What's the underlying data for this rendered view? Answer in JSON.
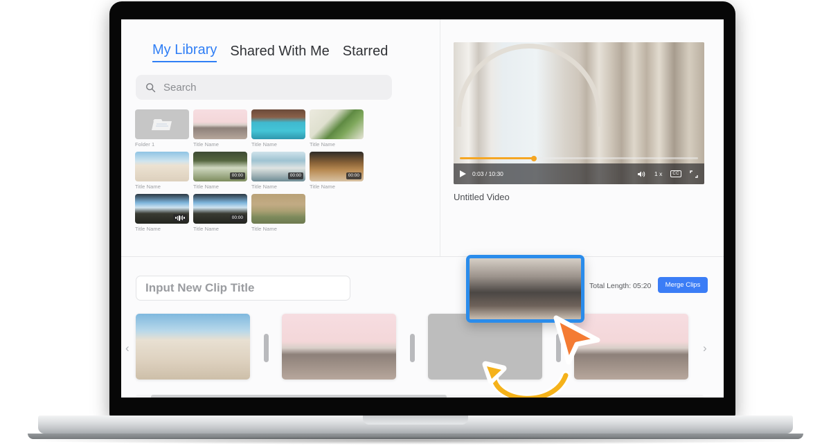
{
  "app": {
    "library": {
      "tabs": [
        {
          "label": "My Library",
          "active": true
        },
        {
          "label": "Shared With Me",
          "active": false
        },
        {
          "label": "Starred",
          "active": false
        }
      ],
      "search": {
        "placeholder": "Search",
        "value": "",
        "icon": "search-icon"
      },
      "items": [
        {
          "label": "Folder 1",
          "kind": "folder",
          "art": "folder",
          "badge": null
        },
        {
          "label": "Title Name",
          "kind": "video",
          "art": "art-van",
          "badge": null
        },
        {
          "label": "Title Name",
          "kind": "video",
          "art": "art-kayak",
          "badge": null
        },
        {
          "label": "Title Name",
          "kind": "video",
          "art": "art-fern",
          "badge": null
        },
        {
          "label": "Title Name",
          "kind": "video",
          "art": "art-beach",
          "badge": null
        },
        {
          "label": "Title Name",
          "kind": "video",
          "art": "art-drink",
          "badge": "00:00"
        },
        {
          "label": "Title Name",
          "kind": "video",
          "art": "art-window",
          "badge": "00:00"
        },
        {
          "label": "Title Name",
          "kind": "video",
          "art": "art-wood",
          "badge": "00:00"
        },
        {
          "label": "Title Name",
          "kind": "audio",
          "art": "art-road",
          "badge": "waveform-icon"
        },
        {
          "label": "Title Name",
          "kind": "video",
          "art": "art-road",
          "badge": "00:00"
        },
        {
          "label": "Title Name",
          "kind": "video",
          "art": "art-dune",
          "badge": null
        }
      ]
    },
    "player": {
      "title": "Untitled Video",
      "current_time": "0:03",
      "duration": "10:30",
      "time_display": "0:03 / 10:30",
      "progress_percent": 31,
      "speed_label": "1 x",
      "captions_label": "CC",
      "controls": [
        "play-icon",
        "volume-icon",
        "speed-label",
        "captions-button",
        "fullscreen-icon"
      ],
      "accent_color": "#f5a623"
    },
    "editor": {
      "clip_title_placeholder": "Input New Clip Title",
      "clip_title_value": "",
      "total_length_label": "Total Length: 05:20",
      "merge_button_label": "Merge Clips",
      "merge_button_color": "#3b7df6",
      "prev_arrow": "‹",
      "next_arrow": "›",
      "timeline_clips": [
        {
          "art": "art-sand",
          "state": "filled"
        },
        {
          "art": "art-van",
          "state": "filled"
        },
        {
          "art": "art-gray",
          "state": "empty-drop-target"
        },
        {
          "art": "art-van",
          "state": "filled"
        }
      ]
    },
    "drag": {
      "card_art": "art-laptop",
      "border_color": "#2a8ceb",
      "cursor_icon": "pointer-arrow-cursor",
      "cursor_color": "#f47b33",
      "hint_arrow_icon": "curved-hint-arrow",
      "hint_arrow_color": "#f5b21a"
    }
  }
}
